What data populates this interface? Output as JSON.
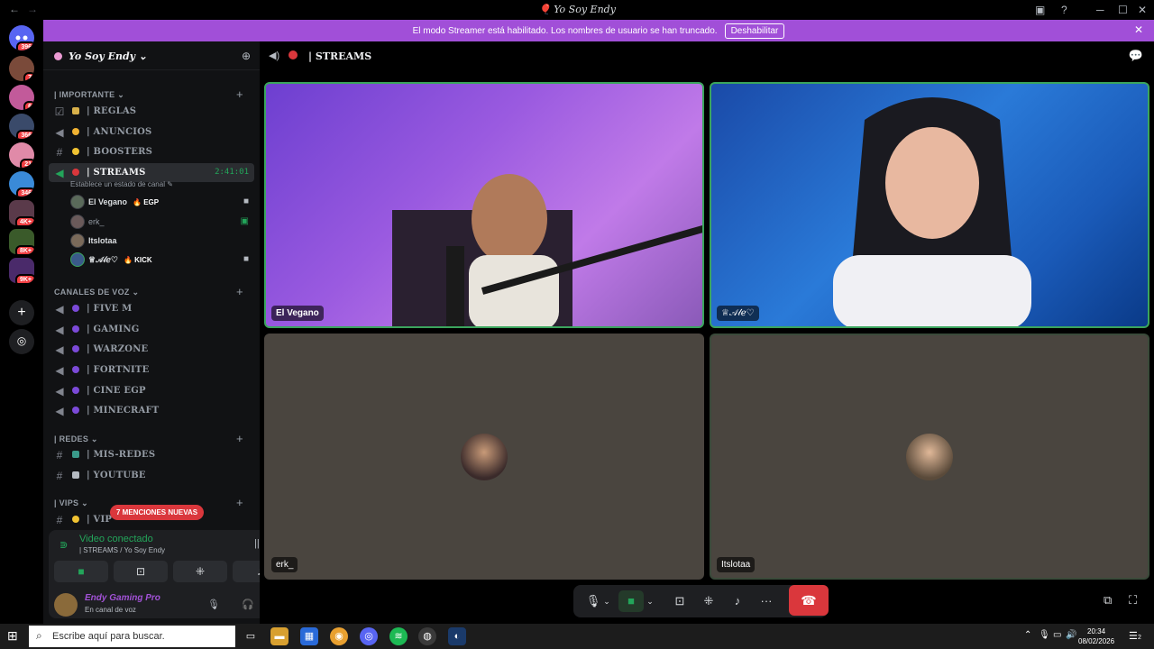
{
  "window": {
    "title": "🎈 Yo Soy Endy"
  },
  "banner": {
    "message": "El modo Streamer está habilitado. Los nombres de usuario se han truncado.",
    "button": "Deshabilitar"
  },
  "guild_badges": [
    "396",
    "7",
    "6",
    "366",
    "21",
    "346",
    "4K+",
    "8K+",
    "9K+"
  ],
  "server": {
    "name": "Yo Soy Endy ⌄"
  },
  "categories": {
    "importante": "| IMPORTANTE ⌄",
    "voz": "CANALES DE VOZ ⌄",
    "redes": "| REDES ⌄",
    "vips": "| VIPS ⌄"
  },
  "channels": {
    "reglas": "| REGLAS",
    "anuncios": "| ANUNCIOS",
    "boosters": "| BOOSTERS",
    "streams": "| STREAMS",
    "streams_time": "2:41:01",
    "streams_status": "Establece un estado de canal ✎",
    "fivem": "| FIVE M",
    "gaming": "| GAMING",
    "warzone": "| WARZONE",
    "fortnite": "| FORTNITE",
    "cine": "| CINE EGP",
    "minecraft": "| MINECRAFT",
    "misredes": "| MIS-REDES",
    "youtube": "| YOUTUBE",
    "vip": "| VIP"
  },
  "voice_users": [
    {
      "name": "El Vegano",
      "badge": "🔥 EGP"
    },
    {
      "name": "erk_",
      "badge": ""
    },
    {
      "name": "Itslotaa",
      "badge": ""
    },
    {
      "name": "♕𝒜𝓁ℯ♡",
      "badge": "🔥 KICK"
    }
  ],
  "mentions": "7 MENCIONES NUEVAS",
  "voice_panel": {
    "status": "Video conectado",
    "location": "| STREAMS / Yo Soy Endy"
  },
  "user": {
    "name": "Endy Gaming Pro",
    "status": "En canal de voz"
  },
  "call": {
    "channel": "| STREAMS"
  },
  "tiles": [
    {
      "name": "El Vegano"
    },
    {
      "name": "♕𝒜𝓁ℯ♡"
    },
    {
      "name": "erk_"
    },
    {
      "name": "Itslotaa"
    }
  ],
  "taskbar": {
    "search_placeholder": "Escribe aquí para buscar.",
    "time": "20:34",
    "date": "08/02/2026",
    "notif": "2"
  },
  "colors": {
    "streamer_banner": "#a14fd8",
    "speaking": "#3ba55d",
    "end_call": "#da373c"
  }
}
